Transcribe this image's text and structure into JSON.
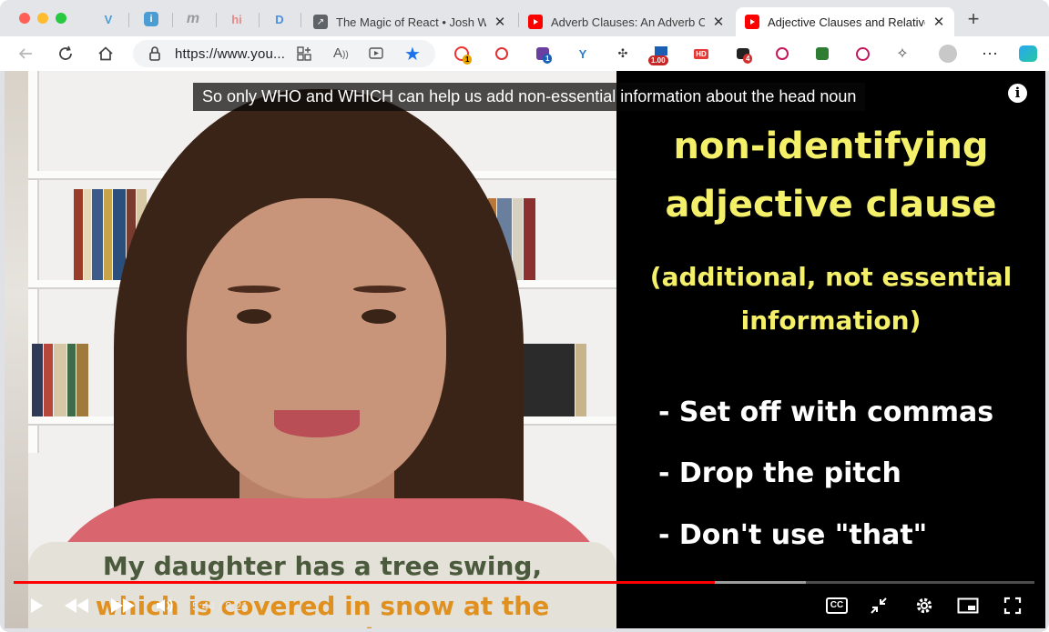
{
  "browser": {
    "pinned_tabs": [
      {
        "icon": "vimeo-icon",
        "color": "#4b9cd3"
      },
      {
        "icon": "info-icon",
        "color": "#4b9cd3"
      },
      {
        "icon": "medium-m-icon",
        "color": "#9a9a9a"
      },
      {
        "icon": "hi-icon",
        "color": "#e58a8a"
      },
      {
        "icon": "d-logo-icon",
        "color": "#4b8fe0"
      }
    ],
    "tabs": [
      {
        "title": "The Magic of React • Josh W C",
        "icon": "arrow-link-icon",
        "icon_color": "#5f6368"
      },
      {
        "title": "Adverb Clauses: An Adverb Cla",
        "icon": "youtube-icon",
        "icon_color": "#ff0000"
      },
      {
        "title": "Adjective Clauses and Relative",
        "icon": "youtube-icon",
        "icon_color": "#ff0000",
        "active": true
      }
    ],
    "address": {
      "url": "https://www.you..."
    },
    "extension_badges": {
      "ext1": "1",
      "ext3": "1",
      "speed": "1.00",
      "hd": "HD",
      "ext7": "4"
    }
  },
  "video": {
    "caption": "So only WHO and WHICH can help us add non-essential information about the head noun",
    "slide": {
      "title_line1": "non-identifying",
      "title_line2": "adjective clause",
      "sub_line1": "(additional, not essential",
      "sub_line2": "information)",
      "bullets": [
        "- Set off with commas",
        "- Drop the pitch",
        "- Don't use \"that\""
      ]
    },
    "burned_subtitle": {
      "line1": "My daughter has a tree swing,",
      "line2": "which is covered in snow at the moment."
    },
    "player": {
      "time": "5:44 / 8:21",
      "progress_played": 0.687,
      "progress_buffered": 0.776,
      "accent_color": "#ff0000"
    }
  }
}
